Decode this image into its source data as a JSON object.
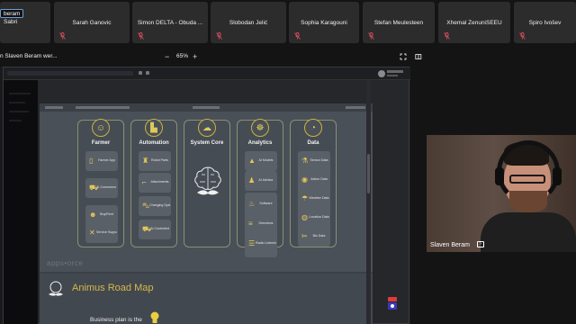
{
  "self_tag": "beram",
  "participants": [
    {
      "name": "Sabri"
    },
    {
      "name": "Sarah Ganovic"
    },
    {
      "name": "Simon DELTA - Óbuda ..."
    },
    {
      "name": "Slobodan Jelić"
    },
    {
      "name": "Sophia Karagouni"
    },
    {
      "name": "Stefan Meulesteen"
    },
    {
      "name": "Xhemal ZenuniSEEU"
    },
    {
      "name": "Špiro Ivošev"
    }
  ],
  "share": {
    "title": "n Slaven Beram wer...",
    "zoom_minus": "−",
    "zoom": "65%",
    "zoom_plus": "+"
  },
  "slide": {
    "columns": [
      {
        "title": "Farmer",
        "icon": "farmer-icon",
        "items": [
          "Farmer App",
          "E-Commerce",
          "Buy/Rent",
          "Service Support"
        ]
      },
      {
        "title": "Automation",
        "icon": "factory-icon",
        "items": [
          "Robot Parts",
          "Attachments",
          "Changing System",
          "AI Controlled"
        ]
      },
      {
        "title": "System Core",
        "icon": "cloud-icon",
        "items": []
      },
      {
        "title": "Analytics",
        "icon": "head-gear-icon",
        "items": [
          "AI Models",
          "AI Advisor",
          "Software",
          "Directions",
          "Radio Listening"
        ]
      },
      {
        "title": "Data",
        "icon": "gauge-icon",
        "items": [
          "Sensor Data",
          "Action Data",
          "Weather Data",
          "Location Data",
          "Bio Data"
        ]
      }
    ],
    "appsforce": "apps•orce",
    "roadmap_title": "Animus Road Map",
    "roadmap_text": "Business plan is the"
  },
  "video": {
    "name": "Slaven Beram"
  },
  "colors": {
    "accent_gold": "#d6b84a",
    "panel_border": "#8c8f73",
    "slide_bg": "#4a5058"
  }
}
